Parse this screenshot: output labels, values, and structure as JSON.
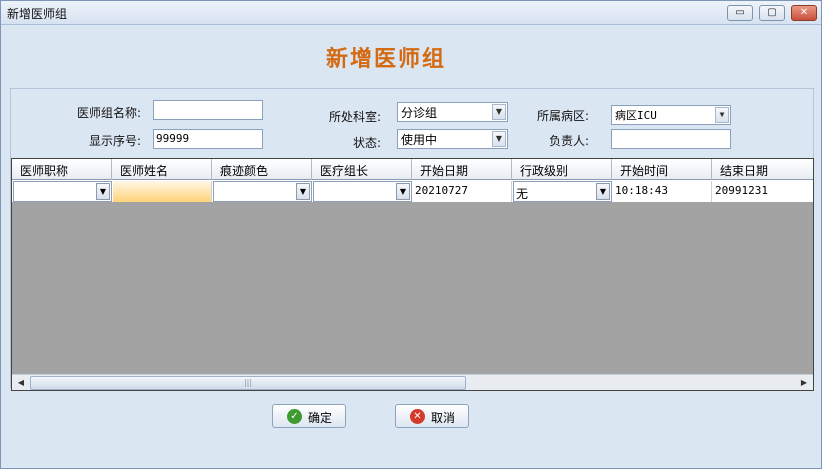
{
  "window": {
    "title": "新增医师组",
    "minimize_label": "▭",
    "restore_label": "▢",
    "close_label": "✕"
  },
  "heading": "新增医师组",
  "form": {
    "group_name_label": "医师组名称:",
    "group_name_value": "",
    "order_label": "显示序号:",
    "order_value": "99999",
    "dept_label": "所处科室:",
    "dept_value": "分诊组",
    "status_label": "状态:",
    "status_value": "使用中",
    "ward_label": "所属病区:",
    "ward_value": "病区ICU",
    "owner_label": "负责人:",
    "owner_value": ""
  },
  "grid": {
    "columns": [
      "医师职称",
      "医师姓名",
      "痕迹颜色",
      "医疗组长",
      "开始日期",
      "行政级别",
      "开始时间",
      "结束日期"
    ],
    "row": {
      "title": "",
      "name": "",
      "color": "",
      "leader": "",
      "start_date": "20210727",
      "admin_level": "无",
      "start_time": "10:18:43",
      "end_date": "20991231"
    }
  },
  "buttons": {
    "ok_label": "确定",
    "cancel_label": "取消"
  },
  "icons": {
    "dropdown": "chevron-down-icon",
    "ok": "check-icon",
    "cancel": "cross-icon"
  }
}
